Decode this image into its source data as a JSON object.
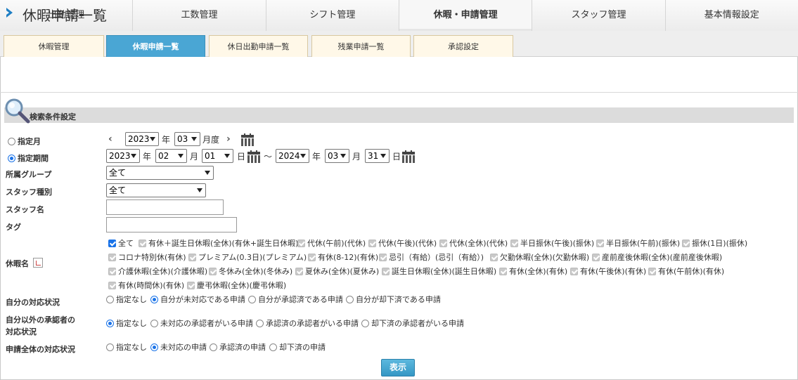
{
  "main_tabs": [
    "出勤管理",
    "工数管理",
    "シフト管理",
    "休暇・申請管理",
    "スタッフ管理",
    "基本情報設定"
  ],
  "sub_tabs": [
    "休暇管理",
    "休暇申請一覧",
    "休日出勤申請一覧",
    "残業申請一覧",
    "承認設定"
  ],
  "page_title": "休暇申請一覧",
  "section_title": "検索条件設定",
  "month_filter": {
    "label": "指定月",
    "year": "2023",
    "year_unit": "年",
    "month": "03",
    "month_unit": "月度"
  },
  "period_filter": {
    "label": "指定期間",
    "from_year": "2023",
    "from_month": "02",
    "from_day": "01",
    "to_year": "2024",
    "to_month": "03",
    "to_day": "31",
    "year_unit": "年",
    "month_unit": "月",
    "day_unit": "日",
    "separator": "～"
  },
  "group": {
    "label": "所属グループ",
    "value": "全て"
  },
  "staff_type": {
    "label": "スタッフ種別",
    "value": "全て"
  },
  "staff_name": {
    "label": "スタッフ名",
    "value": ""
  },
  "tag": {
    "label": "タグ",
    "value": ""
  },
  "leave_name": {
    "label": "休暇名",
    "options": [
      [
        "全て",
        "有休＋誕生日休暇(全休)(有休+誕生日休暇)",
        "代休(午前)(代休)",
        "代休(午後)(代休)",
        "代休(全休)(代休)",
        "半日振休(午後)(振休)",
        "半日振休(午前)(振休)",
        "振休(1日)(振休)"
      ],
      [
        "コロナ特別休(有休)",
        "プレミアム(0.3日)(プレミアム)",
        "有休(8-12)(有休)",
        "忌引（有給）(忌引（有給）)",
        "欠勤休暇(全休)(欠勤休暇)",
        "産前産後休暇(全休)(産前産後休暇)"
      ],
      [
        "介護休暇(全休)(介護休暇)",
        "冬休み(全休)(冬休み)",
        "夏休み(全休)(夏休み)",
        "誕生日休暇(全休)(誕生日休暇)",
        "有休(全休)(有休)",
        "有休(午後休)(有休)",
        "有休(午前休)(有休)"
      ],
      [
        "有休(時間休)(有休)",
        "慶弔休暇(全休)(慶弔休暇)"
      ]
    ]
  },
  "own_status": {
    "label": "自分の対応状況",
    "options": [
      "指定なし",
      "自分が未対応である申請",
      "自分が承認済である申請",
      "自分が却下済である申請"
    ],
    "selected": 1
  },
  "other_status": {
    "label_line1": "自分以外の承認者の",
    "label_line2": "対応状況",
    "options": [
      "指定なし",
      "未対応の承認者がいる申請",
      "承認済の承認者がいる申請",
      "却下済の承認者がいる申請"
    ],
    "selected": 0
  },
  "overall_status": {
    "label": "申請全体の対応状況",
    "options": [
      "指定なし",
      "未対応の申請",
      "承認済の申請",
      "却下済の申請"
    ],
    "selected": 1
  },
  "submit_label": "表示",
  "colors": {
    "accent": "#4aa6d4",
    "radio_on": "#1a73e8",
    "title_arrow": "#1f7fc4"
  }
}
